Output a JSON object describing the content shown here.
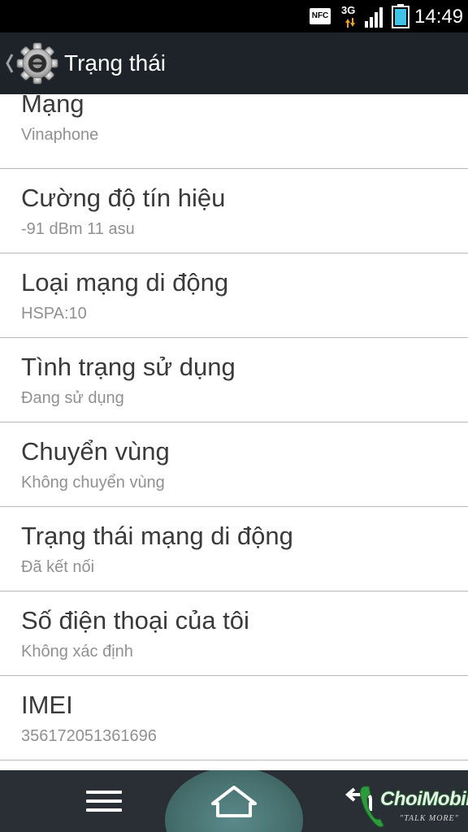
{
  "status_bar": {
    "nfc_label": "NFC",
    "network_type": "3G",
    "time": "14:49",
    "icons": [
      "nfc-icon",
      "data-activity-icon",
      "signal-strength-icon",
      "battery-icon"
    ]
  },
  "action_bar": {
    "title": "Trạng thái",
    "icons": [
      "back-chevron-icon",
      "settings-gear-icon"
    ]
  },
  "items": [
    {
      "title": "Mạng",
      "value": "Vinaphone"
    },
    {
      "title": "Cường độ tín hiệu",
      "value": "-91 dBm   11 asu"
    },
    {
      "title": "Loại mạng di động",
      "value": "HSPA:10"
    },
    {
      "title": "Tình trạng sử dụng",
      "value": "Đang sử dụng"
    },
    {
      "title": "Chuyển vùng",
      "value": "Không chuyển vùng"
    },
    {
      "title": "Trạng thái mạng di động",
      "value": "Đã kết nối"
    },
    {
      "title": "Số điện thoại của tôi",
      "value": "Không xác định"
    },
    {
      "title": "IMEI",
      "value": "356172051361696"
    }
  ],
  "nav_bar": {
    "icons": [
      "menu-icon",
      "home-icon",
      "back-icon"
    ]
  },
  "watermark": {
    "brand": "ChoiMobile",
    "slogan": "\"TALK MORE\""
  },
  "colors": {
    "status_bar": "#000000",
    "action_bar": "#1e2329",
    "nav_bar": "#2a2f35",
    "home_highlight": "#4f7c7c",
    "title_text": "#3a3a3a",
    "value_text": "#909090",
    "divider": "#b8b8b8",
    "battery": "#3fc3e6"
  }
}
